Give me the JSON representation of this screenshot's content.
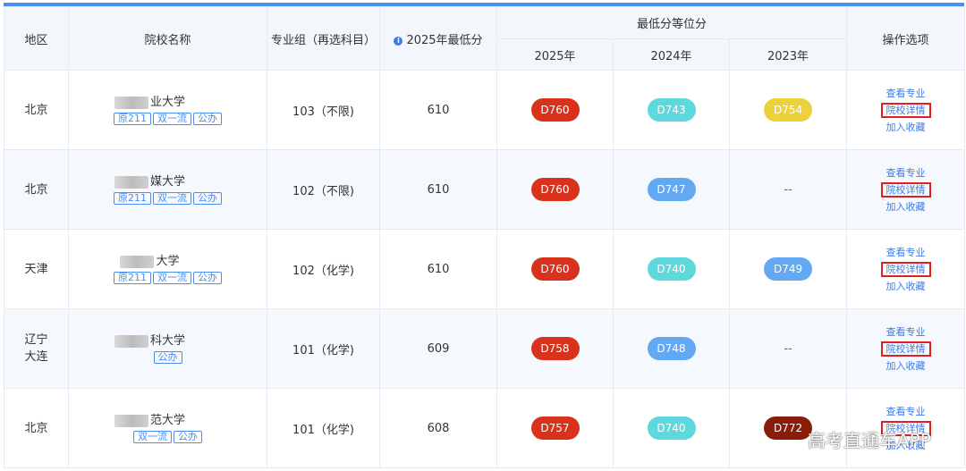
{
  "header": {
    "region": "地区",
    "school": "院校名称",
    "group": "专业组（再选科目）",
    "min_score_2025": "2025年最低分",
    "info_icon": "i",
    "rank_group": "最低分等位分",
    "year_2025": "2025年",
    "year_2024": "2024年",
    "year_2023": "2023年",
    "actions": "操作选项"
  },
  "actions": {
    "view_majors": "查看专业",
    "school_details": "院校详情",
    "add_favorite": "加入收藏"
  },
  "rows": [
    {
      "region": "北京",
      "school": "业大学",
      "tags": [
        "原211",
        "双一流",
        "公办"
      ],
      "group": "103（不限)",
      "min_score": "610",
      "rank_2025": "D760",
      "rank_2024": "D743",
      "rank_2023": "D754"
    },
    {
      "region": "北京",
      "school": "媒大学",
      "tags": [
        "原211",
        "双一流",
        "公办"
      ],
      "group": "102（不限)",
      "min_score": "610",
      "rank_2025": "D760",
      "rank_2024": "D747",
      "rank_2023": "--"
    },
    {
      "region": "天津",
      "school": "大学",
      "tags": [
        "原211",
        "双一流",
        "公办"
      ],
      "group": "102（化学)",
      "min_score": "610",
      "rank_2025": "D760",
      "rank_2024": "D740",
      "rank_2023": "D749"
    },
    {
      "region": "辽宁\n大连",
      "school": "科大学",
      "tags": [
        "公办"
      ],
      "group": "101（化学)",
      "min_score": "609",
      "rank_2025": "D758",
      "rank_2024": "D748",
      "rank_2023": "--"
    },
    {
      "region": "北京",
      "school": "范大学",
      "tags": [
        "双一流",
        "公办"
      ],
      "group": "101（化学)",
      "min_score": "608",
      "rank_2025": "D757",
      "rank_2024": "D740",
      "rank_2023": "D772"
    }
  ],
  "colors": {
    "rank_2025": "#d8321c",
    "rank_2024_teal": "#5dd8dc",
    "rank_2024_blue": "#62a8f2",
    "rank_2023_yellow": "#ecd03c",
    "rank_2023_blue": "#62a8f2",
    "rank_2023_darkred": "#8a1d0a",
    "accent": "#4a8ff0",
    "highlight_box": "#e02020"
  },
  "watermark": "高考直通车APP"
}
